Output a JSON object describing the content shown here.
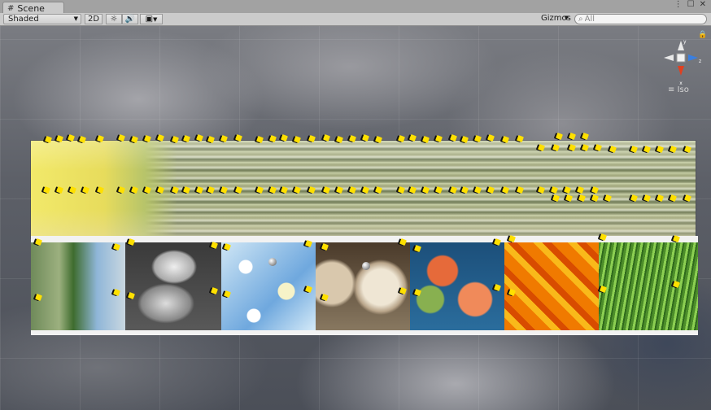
{
  "window": {
    "tab_label": "Scene",
    "tab_icon": "hash-grid-icon",
    "controls": [
      "⋮",
      "☐",
      "✕"
    ]
  },
  "toolbar": {
    "draw_mode": "Shaded",
    "mode_2d": "2D",
    "lighting_icon": "sun-icon",
    "audio_icon": "speaker-icon",
    "effects_icon": "image-icon",
    "gizmos": "Gizmos",
    "search_placeholder": "All"
  },
  "scene_gizmo": {
    "axis_y": "y",
    "axis_z": "z",
    "axis_x": "x",
    "view_label": "Iso"
  },
  "colors": {
    "marker": "#ffe000",
    "toolbar_bg": "#cbcbcb",
    "gizmo_x": "#e04020",
    "gizmo_z": "#3a7fe0"
  }
}
